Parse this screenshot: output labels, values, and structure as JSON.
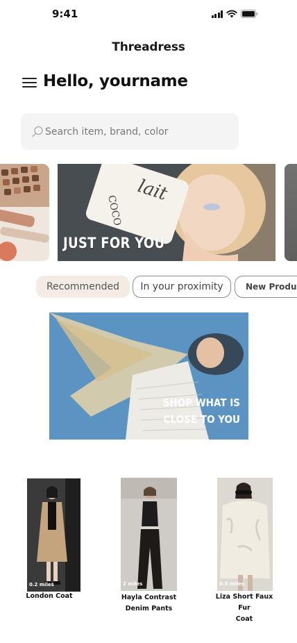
{
  "status_bar": {
    "time": "9:41"
  },
  "app": {
    "title": "Threadress"
  },
  "header": {
    "greeting": "Hello, yourname"
  },
  "search": {
    "placeholder": "Search item, brand, color"
  },
  "carousel": {
    "main_card_label": "JUST FOR YOU"
  },
  "tabs": [
    {
      "label": "Recommended",
      "active": true
    },
    {
      "label": "In your proximity",
      "active": false
    },
    {
      "label": "New Product",
      "active": false
    }
  ],
  "promo": {
    "line1": "SHOP WHAT IS",
    "line2": "CLOSE TO YOU"
  },
  "products": [
    {
      "distance": "0.2 miles",
      "name_line1": "London Coat",
      "name_line2": ""
    },
    {
      "distance": "2 miles",
      "name_line1": "Hayla Contrast",
      "name_line2": "Denim Pants"
    },
    {
      "distance": "0.5 miles",
      "name_line1": "Liza Short Faux Fur",
      "name_line2": "Coat"
    }
  ],
  "colors": {
    "active_tab_bg": "#f3ebe4",
    "search_bg": "#f4f4f4"
  }
}
